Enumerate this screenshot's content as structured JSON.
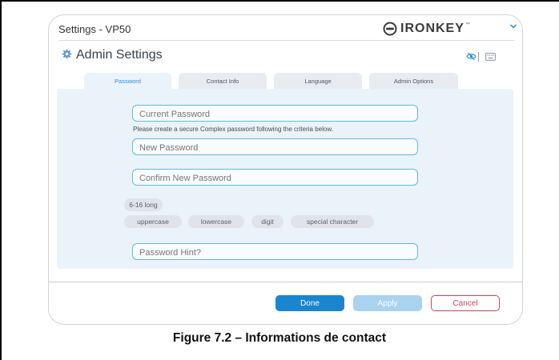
{
  "window": {
    "title": "Settings - VP50",
    "logo_text": "IRONKEY",
    "logo_tm": "™"
  },
  "header": {
    "title": "Admin Settings"
  },
  "tabs": [
    {
      "label": "Password",
      "active": true
    },
    {
      "label": "Contact Info",
      "active": false
    },
    {
      "label": "Language",
      "active": false
    },
    {
      "label": "Admin Options",
      "active": false
    }
  ],
  "form": {
    "current_password_placeholder": "Current Password",
    "hint_text": "Please create a secure Complex password following the criteria below.",
    "new_password_placeholder": "New Password",
    "confirm_password_placeholder": "Confirm New Password",
    "password_hint_placeholder": "Password Hint?"
  },
  "criteria": [
    "6-16 long",
    "uppercase",
    "lowercase",
    "digit",
    "special character"
  ],
  "buttons": {
    "done": "Done",
    "apply": "Apply",
    "cancel": "Cancel"
  },
  "caption": "Figure 7.2 – Informations de contact",
  "colors": {
    "accent": "#1a85cf",
    "field_border": "#62b8e4",
    "panel_bg": "#eaf3fa",
    "cancel": "#d0405f"
  }
}
